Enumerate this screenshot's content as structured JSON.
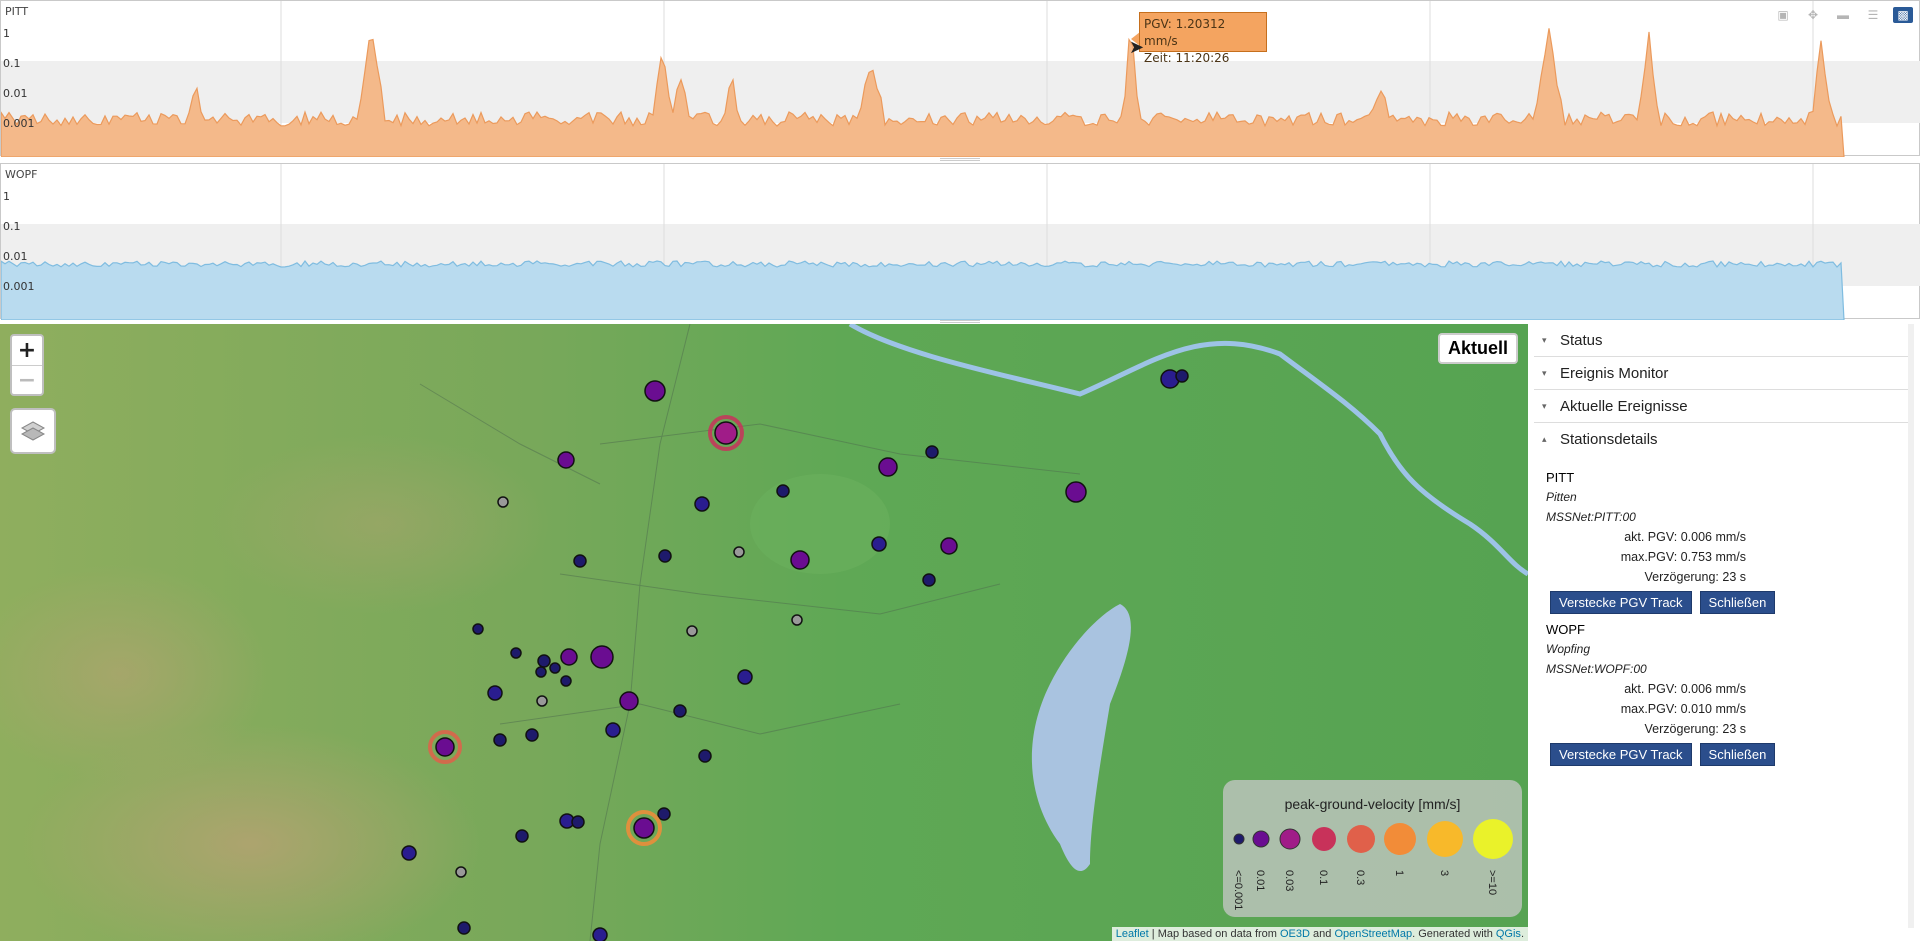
{
  "plots": {
    "pitt": {
      "label": "PITT",
      "yticks": [
        "1",
        "0.1",
        "0.01",
        "0.001"
      ],
      "color": "#f4a460"
    },
    "wopf": {
      "label": "WOPF",
      "yticks": [
        "1",
        "0.1",
        "0.01",
        "0.001"
      ],
      "color": "#a8d3ec"
    }
  },
  "tooltip": {
    "pgv": "PGV:  1.20312 mm/s",
    "zeit": "Zeit:  11:20:26"
  },
  "modebar": [
    "camera-icon",
    "pan-icon",
    "zoom-icon",
    "compare-icon",
    "chart-icon"
  ],
  "map": {
    "aktuell": "Aktuell",
    "zoom_in": "+",
    "zoom_out": "−",
    "legend": {
      "title": "peak-ground-velocity [mm/s]",
      "labels": [
        "<=0.001",
        "0.01",
        "0.03",
        "0.1",
        "0.3",
        "1",
        "3",
        ">=10"
      ],
      "colors": [
        "#1e1a6b",
        "#6a0d91",
        "#a01c88",
        "#c8325a",
        "#e0604a",
        "#f28c38",
        "#f8b92a",
        "#eaf22a"
      ]
    },
    "attribution": {
      "leaflet": "Leaflet",
      "text1": " | Map based on data from ",
      "oe3d": "OE3D",
      "and": " and ",
      "osm": "OpenStreetMap",
      "text2": ". Generated with ",
      "qgis": "QGis",
      "end": "."
    }
  },
  "panel": {
    "sections": [
      {
        "title": "Status",
        "caret": "▾"
      },
      {
        "title": "Ereignis Monitor",
        "caret": "▾"
      },
      {
        "title": "Aktuelle Ereignisse",
        "caret": "▾"
      },
      {
        "title": "Stationsdetails",
        "caret": "▴"
      }
    ],
    "stations": [
      {
        "code": "PITT",
        "name": "Pitten",
        "net": "MSSNet:PITT:00",
        "akt": "akt. PGV: 0.006 mm/s",
        "max": "max.PGV: 0.753 mm/s",
        "delay": "Verzögerung: 23 s",
        "btn_hide": "Verstecke PGV Track",
        "btn_close": "Schließen"
      },
      {
        "code": "WOPF",
        "name": "Wopfing",
        "net": "MSSNet:WOPF:00",
        "akt": "akt. PGV: 0.006 mm/s",
        "max": "max.PGV: 0.010 mm/s",
        "delay": "Verzögerung: 23 s",
        "btn_hide": "Verstecke PGV Track",
        "btn_close": "Schließen"
      }
    ]
  }
}
